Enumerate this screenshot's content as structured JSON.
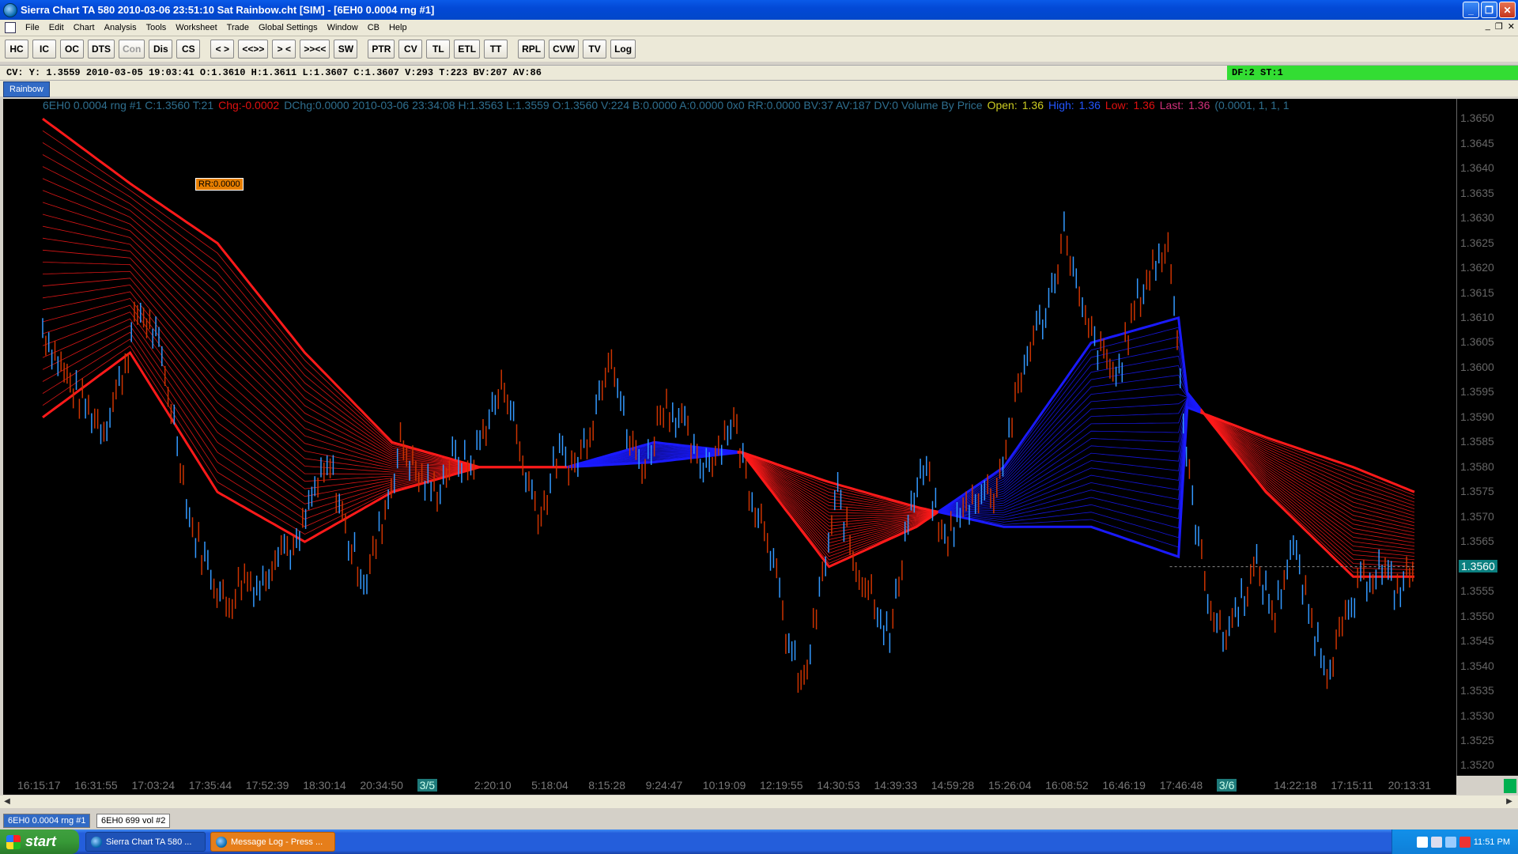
{
  "window": {
    "title": "Sierra Chart TA 580  2010-03-06  23:51:10  Sat   Rainbow.cht [SIM]  - [6EH0  0.0004 rng  #1]",
    "minimize": "_",
    "restore": "❐",
    "close": "✕"
  },
  "menu": [
    "File",
    "Edit",
    "Chart",
    "Analysis",
    "Tools",
    "Worksheet",
    "Trade",
    "Global Settings",
    "Window",
    "CB",
    "Help"
  ],
  "mdi_buttons": [
    "_",
    "❐",
    "✕"
  ],
  "toolbar": [
    "HC",
    "IC",
    "OC",
    "DTS",
    "Con",
    "Dis",
    "CS",
    "< >",
    "<<>>",
    "> <",
    ">><<",
    "SW",
    "PTR",
    "CV",
    "TL",
    "ETL",
    "TT",
    "RPL",
    "CVW",
    "TV",
    "Log"
  ],
  "cursor_values": "CV: Y: 1.3559  2010-03-05  19:03:41  O:1.3610  H:1.3611  L:1.3607  C:1.3607  V:293  T:223  BV:207  AV:86",
  "df_st": "DF:2  ST:1",
  "study_tab": "Rainbow",
  "chart_header": {
    "symbol_info": "6EH0  0.0004 rng  #1 C:1.3560 T:21",
    "chg": "Chg:-0.0002",
    "rest": "DChg:0.0000 2010-03-06 23:34:08 H:1.3563 L:1.3559 O:1.3560 V:224 B:0.0000 A:0.0000 0x0 RR:0.0000 BV:37 AV:187 DV:0 Volume By Price",
    "open_label": "Open:",
    "open_val": "1.36",
    "high_label": "High:",
    "high_val": "1.36",
    "low_label": "Low:",
    "low_val": "1.36",
    "last_label": "Last:",
    "last_val": "1.36",
    "params": "(0.0001, 1, 1, 1"
  },
  "rr_label": "RR:0.0000",
  "colors": {
    "band_red": "#ff1a1a",
    "band_blue": "#1a1aff",
    "bar_blue": "#3399ff",
    "bar_red": "#cc3300",
    "price_marker": "#0b8080"
  },
  "chart_data": {
    "type": "line",
    "ylim": [
      1.3518,
      1.3654
    ],
    "y_ticks": [
      "1.3650",
      "1.3645",
      "1.3640",
      "1.3635",
      "1.3630",
      "1.3625",
      "1.3620",
      "1.3615",
      "1.3610",
      "1.3605",
      "1.3600",
      "1.3595",
      "1.3590",
      "1.3585",
      "1.3580",
      "1.3575",
      "1.3570",
      "1.3565",
      "1.3560",
      "1.3555",
      "1.3550",
      "1.3545",
      "1.3540",
      "1.3535",
      "1.3530",
      "1.3525",
      "1.3520"
    ],
    "last_price": "1.3560",
    "x_ticks": [
      "16:15:17",
      "16:31:55",
      "17:03:24",
      "17:35:44",
      "17:52:39",
      "18:30:14",
      "20:34:50",
      "3/5",
      "2:20:10",
      "5:18:04",
      "8:15:28",
      "9:24:47",
      "10:19:09",
      "12:19:55",
      "14:30:53",
      "14:39:33",
      "14:59:28",
      "15:26:04",
      "16:08:52",
      "16:46:19",
      "17:46:48",
      "3/6",
      "14:22:18",
      "17:15:11",
      "20:13:31"
    ],
    "day_marker_ticks": [
      "3/5",
      "3/6"
    ],
    "price_path": [
      [
        0,
        1.3608
      ],
      [
        3,
        1.3597
      ],
      [
        5,
        1.3592
      ],
      [
        7,
        1.3588
      ],
      [
        9,
        1.3598
      ],
      [
        11,
        1.3612
      ],
      [
        13,
        1.3606
      ],
      [
        15,
        1.359
      ],
      [
        17,
        1.3568
      ],
      [
        19,
        1.356
      ],
      [
        21,
        1.3552
      ],
      [
        23,
        1.3558
      ],
      [
        25,
        1.3556
      ],
      [
        27,
        1.3565
      ],
      [
        29,
        1.3563
      ],
      [
        31,
        1.3575
      ],
      [
        33,
        1.358
      ],
      [
        35,
        1.3565
      ],
      [
        37,
        1.3557
      ],
      [
        39,
        1.357
      ],
      [
        41,
        1.3585
      ],
      [
        43,
        1.3578
      ],
      [
        45,
        1.3575
      ],
      [
        47,
        1.3582
      ],
      [
        49,
        1.358
      ],
      [
        51,
        1.359
      ],
      [
        53,
        1.3597
      ],
      [
        55,
        1.358
      ],
      [
        57,
        1.357
      ],
      [
        59,
        1.3583
      ],
      [
        61,
        1.358
      ],
      [
        63,
        1.359
      ],
      [
        65,
        1.3605
      ],
      [
        67,
        1.3585
      ],
      [
        69,
        1.358
      ],
      [
        71,
        1.3593
      ],
      [
        73,
        1.359
      ],
      [
        75,
        1.358
      ],
      [
        77,
        1.3583
      ],
      [
        79,
        1.359
      ],
      [
        81,
        1.3575
      ],
      [
        83,
        1.3567
      ],
      [
        85,
        1.3547
      ],
      [
        87,
        1.3535
      ],
      [
        89,
        1.3555
      ],
      [
        91,
        1.3575
      ],
      [
        93,
        1.356
      ],
      [
        95,
        1.3555
      ],
      [
        97,
        1.3545
      ],
      [
        99,
        1.357
      ],
      [
        101,
        1.358
      ],
      [
        103,
        1.3565
      ],
      [
        105,
        1.357
      ],
      [
        107,
        1.3575
      ],
      [
        109,
        1.3575
      ],
      [
        111,
        1.359
      ],
      [
        113,
        1.3605
      ],
      [
        115,
        1.3612
      ],
      [
        117,
        1.3628
      ],
      [
        119,
        1.361
      ],
      [
        121,
        1.3603
      ],
      [
        123,
        1.3598
      ],
      [
        125,
        1.3612
      ],
      [
        127,
        1.362
      ],
      [
        129,
        1.3625
      ],
      [
        131,
        1.358
      ],
      [
        133,
        1.3557
      ],
      [
        135,
        1.3545
      ],
      [
        137,
        1.3553
      ],
      [
        139,
        1.356
      ],
      [
        141,
        1.355
      ],
      [
        143,
        1.3565
      ],
      [
        145,
        1.355
      ],
      [
        147,
        1.354
      ],
      [
        149,
        1.3548
      ],
      [
        151,
        1.3557
      ],
      [
        153,
        1.356
      ],
      [
        155,
        1.3555
      ],
      [
        157,
        1.356
      ]
    ],
    "fast_ma": [
      [
        0,
        1.359
      ],
      [
        10,
        1.3603
      ],
      [
        20,
        1.3575
      ],
      [
        30,
        1.3565
      ],
      [
        40,
        1.3575
      ],
      [
        50,
        1.358
      ],
      [
        60,
        1.358
      ],
      [
        70,
        1.3585
      ],
      [
        80,
        1.3583
      ],
      [
        90,
        1.356
      ],
      [
        100,
        1.3568
      ],
      [
        110,
        1.358
      ],
      [
        120,
        1.3605
      ],
      [
        130,
        1.361
      ],
      [
        131,
        1.3595
      ],
      [
        140,
        1.3575
      ],
      [
        150,
        1.3558
      ],
      [
        157,
        1.3558
      ]
    ],
    "slow_ma": [
      [
        0,
        1.365
      ],
      [
        10,
        1.3637
      ],
      [
        20,
        1.3625
      ],
      [
        30,
        1.3603
      ],
      [
        40,
        1.3585
      ],
      [
        50,
        1.358
      ],
      [
        60,
        1.358
      ],
      [
        70,
        1.3581
      ],
      [
        80,
        1.3583
      ],
      [
        90,
        1.3577
      ],
      [
        100,
        1.3572
      ],
      [
        110,
        1.3568
      ],
      [
        120,
        1.3568
      ],
      [
        130,
        1.3562
      ],
      [
        131,
        1.3592
      ],
      [
        140,
        1.3586
      ],
      [
        150,
        1.358
      ],
      [
        157,
        1.3575
      ]
    ]
  },
  "sheet_tabs": [
    "6EH0  0.0004 rng  #1",
    "6EH0  699 vol  #2"
  ],
  "taskbar": {
    "start": "start",
    "tasks": [
      "Sierra Chart TA 580 ...",
      "Message Log - Press ..."
    ],
    "clock": "11:51 PM"
  }
}
